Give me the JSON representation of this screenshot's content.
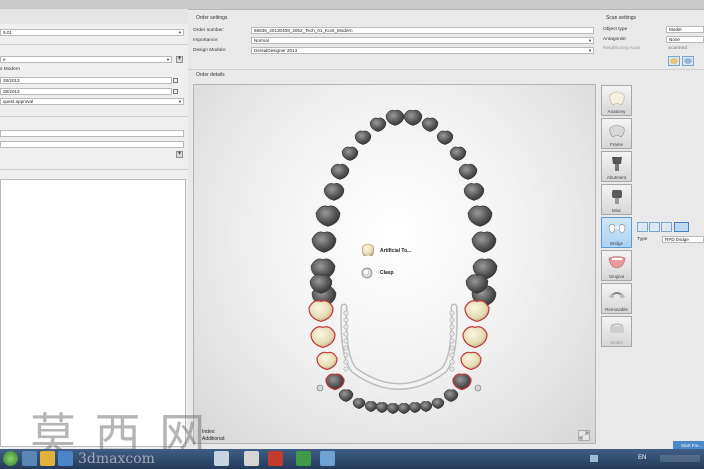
{
  "left_panel": {
    "field_1": "9.01",
    "field_2": "e",
    "field_3_label": "s Modern",
    "date_1": "28/2013",
    "date_2": "28/2013",
    "field_4": "quest approval"
  },
  "order_settings": {
    "title": "Order settings",
    "order_number_label": "Order number:",
    "order_number_value": "66636_20130408_2052_Tech_01_Kunt_Modern",
    "importance_label": "Importance:",
    "importance_value": "Normal",
    "design_module_label": "Design Module:",
    "design_module_value": "DentalDesigner 2013"
  },
  "scan_settings": {
    "title": "Scan settings",
    "object_type_label": "Object type",
    "object_type_value": "Model",
    "antagonist_label": "Antagonist",
    "antagonist_value": "None",
    "neighbor_label": "Neighboring scan",
    "neighbor_value": "Scanned"
  },
  "order_details": {
    "title": "Order details",
    "legend": [
      {
        "label": "Artificial To..."
      },
      {
        "label": "Clasp"
      }
    ],
    "index_label": "Index:",
    "additional_label": "Additional:"
  },
  "categories": [
    {
      "label": "Anatomy",
      "icon": "anatomy-icon"
    },
    {
      "label": "Frame",
      "icon": "frame-icon"
    },
    {
      "label": "Abutment",
      "icon": "abutment-icon"
    },
    {
      "label": "Misc",
      "icon": "misc-icon"
    },
    {
      "label": "Bridge",
      "icon": "bridge-icon"
    },
    {
      "label": "Gingiva",
      "icon": "gingiva-icon"
    },
    {
      "label": "Removable",
      "icon": "removable-icon"
    },
    {
      "label": "Model",
      "icon": "model-icon"
    }
  ],
  "type_panel": {
    "type_label": "Type",
    "type_value": "RPD bridge"
  },
  "status": {
    "start_button": "Start Fre...",
    "clock_en": "EN"
  },
  "watermark": {
    "chinese": "莫 西 网",
    "site": "3dmaxcom"
  },
  "colors": {
    "selected_tooth_outline": "#c0393b",
    "active_category": "#a9d2f4",
    "taskbar": "#2f4b6e"
  }
}
